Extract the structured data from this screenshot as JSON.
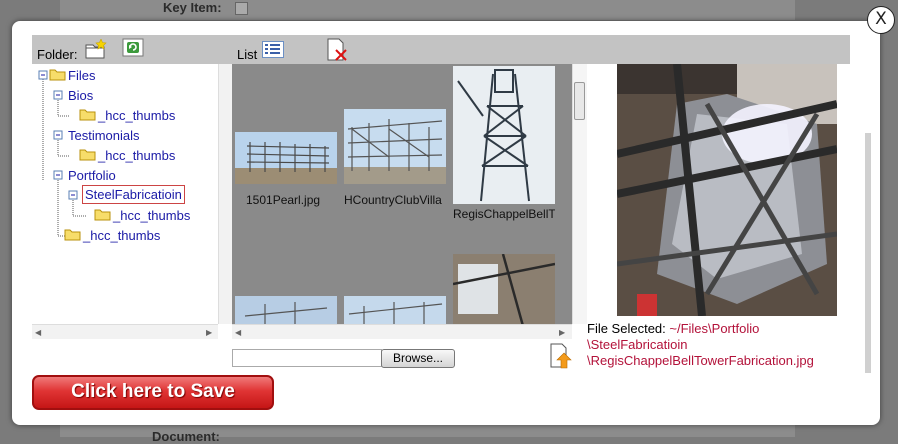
{
  "background": {
    "top_label": "Key Item:",
    "bottom_label": "Document:"
  },
  "close_label": "X",
  "toolbar": {
    "folder_label": "Folder:",
    "list_label": "List"
  },
  "tree": {
    "nodes": [
      {
        "label": "Files"
      },
      {
        "label": "Bios"
      },
      {
        "label": "_hcc_thumbs"
      },
      {
        "label": "Testimonials"
      },
      {
        "label": "_hcc_thumbs"
      },
      {
        "label": "Portfolio"
      },
      {
        "label": "SteelFabricatioin"
      },
      {
        "label": "_hcc_thumbs"
      },
      {
        "label": "_hcc_thumbs"
      }
    ]
  },
  "files": [
    {
      "name": "1501Pearl.jpg"
    },
    {
      "name": "HCountryClubVilla"
    },
    {
      "name": "RegisChappelBellT"
    }
  ],
  "file_selected": {
    "label": "File Selected:",
    "path_line1": "~/Files\\Portfolio",
    "path_line2": "\\SteelFabricatioin",
    "path_line3": "\\RegisChappelBellTowerFabrication.jpg"
  },
  "upload": {
    "browse_label": "Browse..."
  },
  "save_label": "Click here to Save",
  "colors": {
    "link": "#1a1aa6",
    "path": "#b3123a",
    "save_button": "#d62525"
  }
}
